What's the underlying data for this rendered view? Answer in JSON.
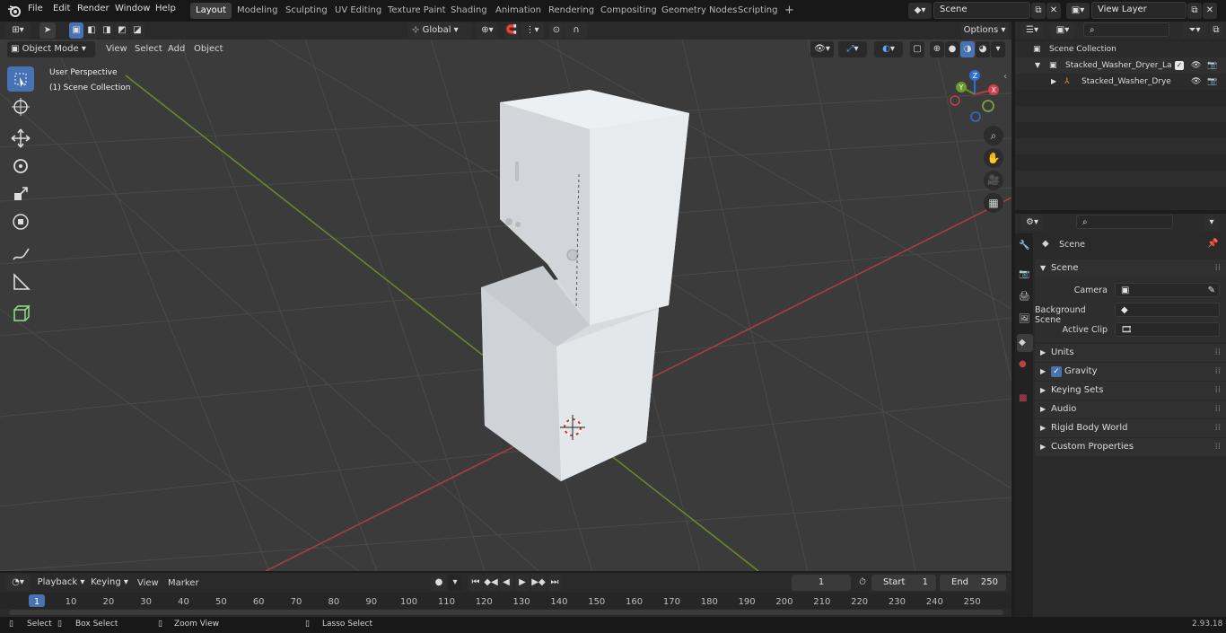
{
  "app": {
    "name": "Blender",
    "version": "2.93.18"
  },
  "menu": [
    "File",
    "Edit",
    "Render",
    "Window",
    "Help"
  ],
  "workspaces": [
    "Layout",
    "Modeling",
    "Sculpting",
    "UV Editing",
    "Texture Paint",
    "Shading",
    "Animation",
    "Rendering",
    "Compositing",
    "Geometry Nodes",
    "Scripting"
  ],
  "active_workspace": "Layout",
  "scene_field": "Scene",
  "view_layer_field": "View Layer",
  "viewport_header": {
    "transform_orientation": "Global",
    "options_label": "Options",
    "mode": "Object Mode",
    "menus": [
      "View",
      "Select",
      "Add",
      "Object"
    ]
  },
  "viewport_overlay": {
    "perspective": "User Perspective",
    "collection": "(1) Scene Collection"
  },
  "gizmo": {
    "z": "Z",
    "y": "Y",
    "x": "X"
  },
  "outliner": {
    "root": "Scene Collection",
    "items": [
      {
        "label": "Stacked_Washer_Dryer_Laun",
        "depth": 1
      },
      {
        "label": "Stacked_Washer_Dryer_L",
        "depth": 2
      }
    ]
  },
  "properties": {
    "context_title": "Scene",
    "scene_panel": "Scene",
    "fields": [
      {
        "label": "Camera",
        "value": ""
      },
      {
        "label": "Background Scene",
        "value": ""
      },
      {
        "label": "Active Clip",
        "value": ""
      }
    ],
    "panels": [
      "Units",
      "Gravity",
      "Keying Sets",
      "Audio",
      "Rigid Body World",
      "Custom Properties"
    ],
    "gravity_checked": true
  },
  "timeline": {
    "menus": [
      "Playback",
      "Keying",
      "View",
      "Marker"
    ],
    "current_frame": "1",
    "start_label": "Start",
    "start_value": "1",
    "end_label": "End",
    "end_value": "250",
    "ruler": [
      "1",
      "10",
      "20",
      "30",
      "40",
      "50",
      "60",
      "70",
      "80",
      "90",
      "100",
      "110",
      "120",
      "130",
      "140",
      "150",
      "160",
      "170",
      "180",
      "190",
      "200",
      "210",
      "220",
      "230",
      "240",
      "250"
    ]
  },
  "statusbar": {
    "items": [
      "Select",
      "Box Select",
      "Zoom View",
      "Lasso Select"
    ],
    "version": "2.93.18"
  },
  "colors": {
    "accent": "#4772b3",
    "x_axis": "#b53a48",
    "y_axis": "#6a8b2a",
    "z_axis": "#2f6fd6"
  }
}
